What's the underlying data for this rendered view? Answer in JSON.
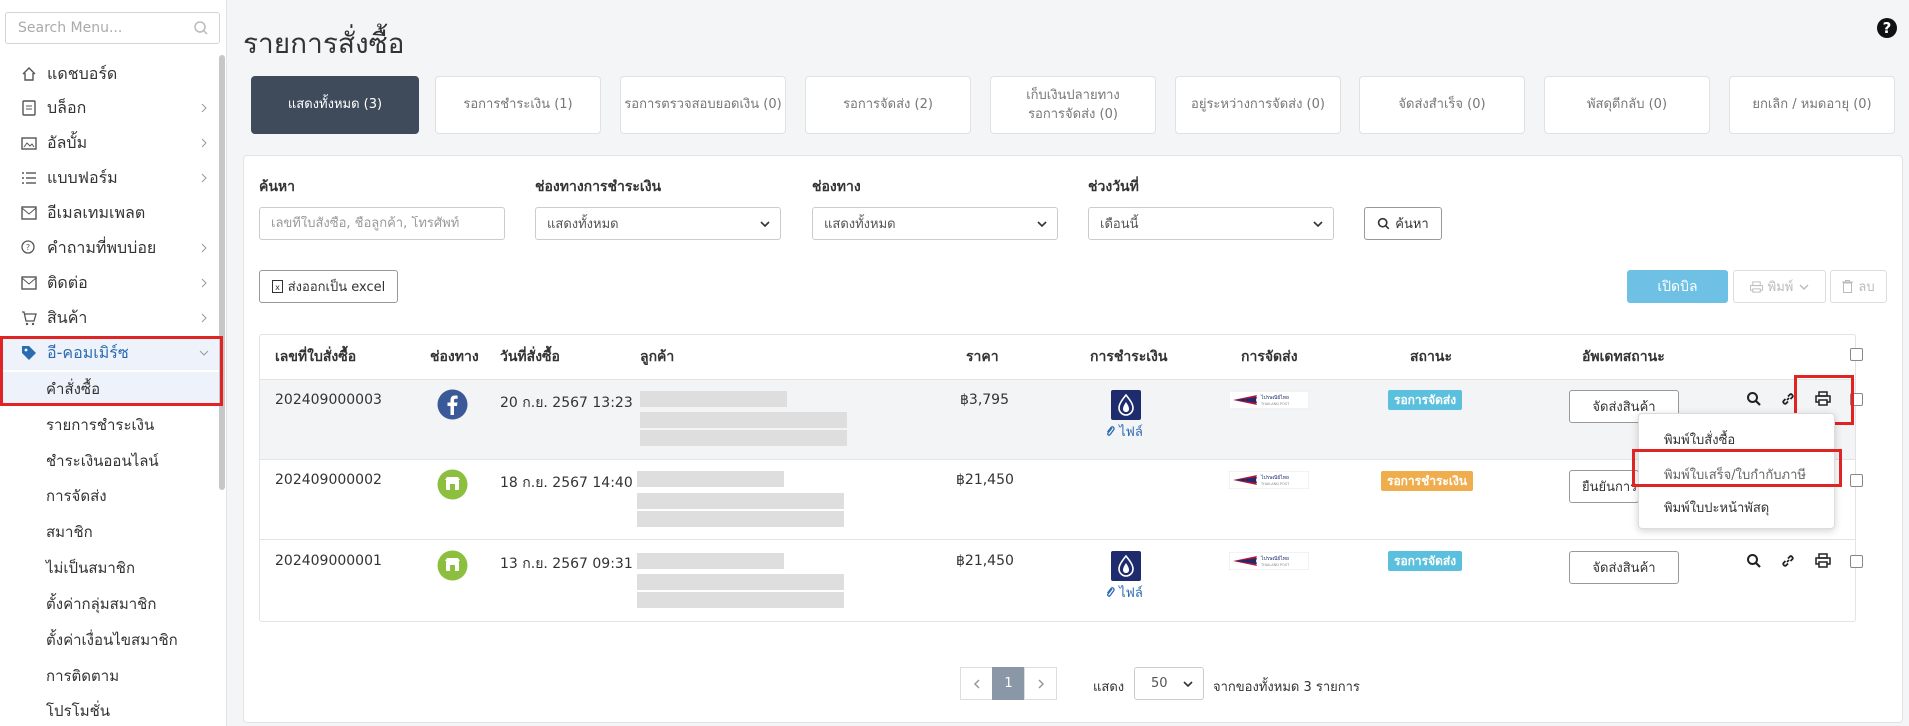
{
  "sidebar": {
    "search_placeholder": "Search Menu...",
    "items": [
      {
        "label": "แดชบอร์ด",
        "icon": "home-icon"
      },
      {
        "label": "บล็อก",
        "icon": "document-icon"
      },
      {
        "label": "อัลบั้ม",
        "icon": "album-icon"
      },
      {
        "label": "แบบฟอร์ม",
        "icon": "form-list-icon"
      },
      {
        "label": "อีเมลเทมเพลต",
        "icon": "mail-icon"
      },
      {
        "label": "คำถามที่พบบ่อย",
        "icon": "faq-icon"
      },
      {
        "label": "ติดต่อ",
        "icon": "mail-icon"
      },
      {
        "label": "สินค้า",
        "icon": "cart-icon"
      },
      {
        "label": "อี-คอมเมิร์ซ",
        "icon": "tag-icon"
      }
    ],
    "subitems": [
      "คำสั่งซื้อ",
      "รายการชำระเงิน",
      "ชำระเงินออนไลน์",
      "การจัดส่ง",
      "สมาชิก",
      "ไม่เป็นสมาชิก",
      "ตั้งค่ากลุ่มสมาชิก",
      "ตั้งค่าเงื่อนไขสมาชิก",
      "การติดตาม",
      "โปรโมชั่น"
    ]
  },
  "page": {
    "title": "รายการสั่งซื้อ",
    "help": "?"
  },
  "tabs": [
    {
      "label": "แสดงทั้งหมด (3)"
    },
    {
      "label": "รอการชำระเงิน (1)"
    },
    {
      "label": "รอการตรวจสอบยอดเงิน (0)"
    },
    {
      "label": "รอการจัดส่ง (2)"
    },
    {
      "label": "เก็บเงินปลายทาง",
      "label2": "รอการจัดส่ง (0)"
    },
    {
      "label": "อยู่ระหว่างการจัดส่ง (0)"
    },
    {
      "label": "จัดส่งสำเร็จ (0)"
    },
    {
      "label": "พัสดุตีกลับ (0)"
    },
    {
      "label": "ยกเลิก / หมดอายุ (0)"
    }
  ],
  "filters": {
    "search_label": "ค้นหา",
    "search_placeholder": "เลขที่ใบสั่งซื้อ, ชื่อลูกค้า, โทรศัพท์",
    "payment_label": "ช่องทางการชำระเงิน",
    "payment_value": "แสดงทั้งหมด",
    "channel_label": "ช่องทาง",
    "channel_value": "แสดงทั้งหมด",
    "date_label": "ช่วงวันที่",
    "date_value": "เดือนนี้",
    "search_button": "ค้นหา"
  },
  "toolbar": {
    "export_label": "ส่งออกเป็น excel",
    "open_bill_label": "เปิดบิล",
    "print_label": "พิมพ์",
    "delete_label": "ลบ"
  },
  "table": {
    "headers": [
      "เลขที่ใบสั่งซื้อ",
      "ช่องทาง",
      "วันที่สั่งซื้อ",
      "ลูกค้า",
      "ราคา",
      "การชำระเงิน",
      "การจัดส่ง",
      "สถานะ",
      "อัพเดทสถานะ"
    ],
    "rows": [
      {
        "order_no": "202409000003",
        "channel": "facebook-icon",
        "date": "20 ก.ย. 2567 13:23",
        "price": "฿3,795",
        "payment_file": "ไฟล์",
        "status": "รอการจัดส่ง",
        "status_color": "#5bc0de",
        "action": "จัดส่งสินค้า"
      },
      {
        "order_no": "202409000002",
        "channel": "store-icon",
        "date": "18 ก.ย. 2567 14:40",
        "price": "฿21,450",
        "payment_file": "",
        "status": "รอการชำระเงิน",
        "status_color": "#f0ad4e",
        "action": "ยืนยันการ"
      },
      {
        "order_no": "202409000001",
        "channel": "store-icon",
        "date": "13 ก.ย. 2567 09:31",
        "price": "฿21,450",
        "payment_file": "ไฟล์",
        "status": "รอการจัดส่ง",
        "status_color": "#5bc0de",
        "action": "จัดส่งสินค้า"
      }
    ]
  },
  "print_menu": [
    "พิมพ์ใบสั่งซื้อ",
    "พิมพ์ใบเสร็จ/ใบกำกับภาษี",
    "พิมพ์ใบปะหน้าพัสดุ"
  ],
  "pagination": {
    "current": "1",
    "show_label": "แสดง",
    "per_page": "50",
    "summary": "จากของทั้งหมด 3 รายการ"
  },
  "colors": {
    "highlight": "#e02424",
    "active_tab": "#3f4b5b",
    "open_bill": "#6ec1e4"
  }
}
